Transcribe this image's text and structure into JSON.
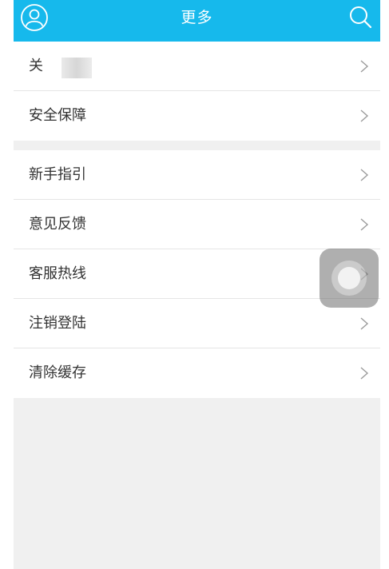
{
  "header": {
    "title": "更多",
    "background": "#16b9ec",
    "left_icon": "user-circle-icon",
    "right_icon": "search-icon"
  },
  "groups": [
    {
      "items": [
        {
          "label": "关",
          "icon": "chevron-right-icon"
        },
        {
          "label": "安全保障",
          "icon": "chevron-right-icon"
        }
      ]
    },
    {
      "items": [
        {
          "label": "新手指引",
          "icon": "chevron-right-icon"
        },
        {
          "label": "意见反馈",
          "icon": "chevron-right-icon"
        },
        {
          "label": "客服热线",
          "icon": "chevron-right-icon"
        },
        {
          "label": "注销登陆",
          "icon": "chevron-right-icon"
        },
        {
          "label": "清除缓存",
          "icon": "chevron-right-icon"
        }
      ]
    }
  ],
  "colors": {
    "accent": "#16b9ec",
    "page_background": "#f0f0f0",
    "row_text": "#333333",
    "divider": "#e5e5e5"
  }
}
